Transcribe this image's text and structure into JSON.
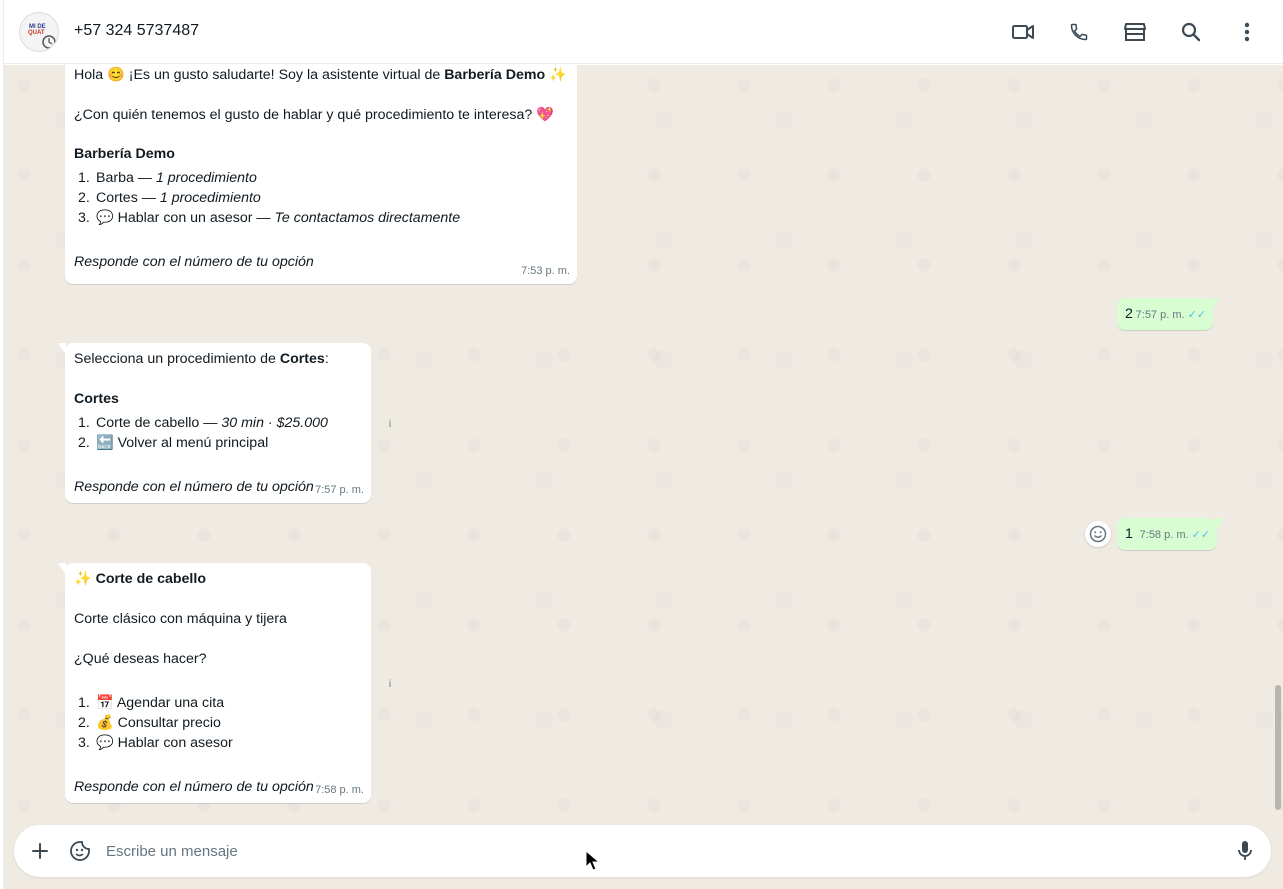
{
  "header": {
    "contact": "+57 324 5737487",
    "avatar_text": "MI DE QUAT",
    "icons": [
      "video-call-icon",
      "phone-icon",
      "store-icon",
      "search-icon",
      "more-icon"
    ]
  },
  "messages": {
    "m1": {
      "greet_a": "Hola 😊 ¡Es un gusto saludarte! Soy la asistente virtual de ",
      "greet_b": "Barbería Demo",
      "greet_c": " ✨",
      "question": "¿Con quién tenemos el gusto de hablar y qué procedimiento te interesa? 💖",
      "section": "Barbería Demo",
      "options": [
        {
          "num": "1.",
          "label": "Barba — ",
          "detail": "1 procedimiento"
        },
        {
          "num": "2.",
          "label": "Cortes — ",
          "detail": "1 procedimiento"
        },
        {
          "num": "3.",
          "label": "💬 Hablar con un asesor — ",
          "detail": "Te contactamos directamente"
        }
      ],
      "footer": "Responde con el número de tu opción",
      "time": "7:53 p. m."
    },
    "m2": {
      "text": "2",
      "time": "7:57 p. m.",
      "ticks": "✓✓"
    },
    "m3": {
      "intro_a": "Selecciona un procedimiento de ",
      "intro_b": "Cortes",
      "intro_c": ":",
      "section": "Cortes",
      "options": [
        {
          "num": "1.",
          "label": "Corte de cabello — ",
          "detail": "30 min · $25.000"
        },
        {
          "num": "2.",
          "label": "🔙 Volver al menú principal",
          "detail": ""
        }
      ],
      "footer": "Responde con el número de tu opción",
      "time": "7:57 p. m."
    },
    "m4": {
      "text": "1",
      "time": "7:58 p. m.",
      "ticks": "✓✓"
    },
    "m5": {
      "title_a": "✨ ",
      "title_b": "Corte de cabello",
      "desc": "Corte clásico con máquina y tijera",
      "question": "¿Qué deseas hacer?",
      "options": [
        {
          "num": "1.",
          "label": "📅 Agendar una cita"
        },
        {
          "num": "2.",
          "label": "💰 Consultar precio"
        },
        {
          "num": "3.",
          "label": "💬 Hablar con asesor"
        }
      ],
      "footer": "Responde con el número de tu opción",
      "time": "7:58 p. m."
    }
  },
  "composer": {
    "placeholder": "Escribe un mensaje"
  },
  "colors": {
    "chat_bg": "#efeae2",
    "incoming": "#ffffff",
    "outgoing": "#d9fdd3",
    "meta": "#667781",
    "tick_blue": "#53bdeb"
  }
}
